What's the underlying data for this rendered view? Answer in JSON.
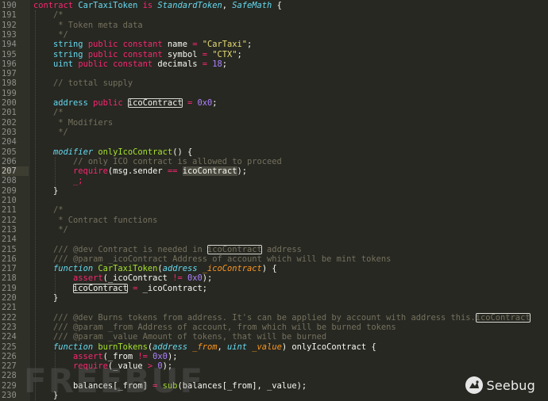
{
  "editor": {
    "active_line": 207,
    "lines": [
      {
        "n": "190",
        "tokens": [
          [
            "kw",
            "contract "
          ],
          [
            "type",
            "CarTaxiToken "
          ],
          [
            "kw",
            "is "
          ],
          [
            "typei",
            "StandardToken"
          ],
          [
            "pl",
            ", "
          ],
          [
            "typei",
            "SafeMath"
          ],
          [
            "pl",
            " {"
          ]
        ]
      },
      {
        "n": "191",
        "tokens": [
          [
            "pl",
            "    "
          ],
          [
            "cmt",
            "/*"
          ]
        ]
      },
      {
        "n": "192",
        "tokens": [
          [
            "pl",
            "    "
          ],
          [
            "cmt",
            " * Token meta data"
          ]
        ]
      },
      {
        "n": "193",
        "tokens": [
          [
            "pl",
            "    "
          ],
          [
            "cmt",
            " */"
          ]
        ]
      },
      {
        "n": "194",
        "tokens": [
          [
            "pl",
            "    "
          ],
          [
            "type",
            "string "
          ],
          [
            "kw",
            "public constant "
          ],
          [
            "pl",
            "name "
          ],
          [
            "kw",
            "= "
          ],
          [
            "str",
            "\"CarTaxi\""
          ],
          [
            "pl",
            ";"
          ]
        ]
      },
      {
        "n": "195",
        "tokens": [
          [
            "pl",
            "    "
          ],
          [
            "type",
            "string "
          ],
          [
            "kw",
            "public constant "
          ],
          [
            "pl",
            "symbol "
          ],
          [
            "kw",
            "= "
          ],
          [
            "str",
            "\"CTX\""
          ],
          [
            "pl",
            ";"
          ]
        ]
      },
      {
        "n": "196",
        "tokens": [
          [
            "pl",
            "    "
          ],
          [
            "type",
            "uint "
          ],
          [
            "kw",
            "public constant "
          ],
          [
            "pl",
            "decimals "
          ],
          [
            "kw",
            "= "
          ],
          [
            "num",
            "18"
          ],
          [
            "pl",
            ";"
          ]
        ]
      },
      {
        "n": "197",
        "tokens": []
      },
      {
        "n": "198",
        "tokens": [
          [
            "pl",
            "    "
          ],
          [
            "cmt",
            "// tottal supply"
          ]
        ]
      },
      {
        "n": "199",
        "tokens": []
      },
      {
        "n": "200",
        "tokens": [
          [
            "pl",
            "    "
          ],
          [
            "type",
            "address "
          ],
          [
            "kw",
            "public "
          ],
          [
            "hl",
            "icoContract"
          ],
          [
            "pl",
            " "
          ],
          [
            "kw",
            "= "
          ],
          [
            "num",
            "0x0"
          ],
          [
            "pl",
            ";"
          ]
        ]
      },
      {
        "n": "201",
        "tokens": [
          [
            "pl",
            "    "
          ],
          [
            "cmt",
            "/*"
          ]
        ]
      },
      {
        "n": "202",
        "tokens": [
          [
            "pl",
            "    "
          ],
          [
            "cmt",
            " * Modifiers"
          ]
        ]
      },
      {
        "n": "203",
        "tokens": [
          [
            "pl",
            "    "
          ],
          [
            "cmt",
            " */"
          ]
        ]
      },
      {
        "n": "204",
        "tokens": []
      },
      {
        "n": "205",
        "tokens": [
          [
            "pl",
            "    "
          ],
          [
            "typei",
            "modifier "
          ],
          [
            "func",
            "onlyIcoContract"
          ],
          [
            "pl",
            "() {"
          ]
        ]
      },
      {
        "n": "206",
        "tokens": [
          [
            "pl",
            "        "
          ],
          [
            "cmt",
            "// only ICO contract is allowed to proceed"
          ]
        ]
      },
      {
        "n": "207",
        "tokens": [
          [
            "pl",
            "        "
          ],
          [
            "kw",
            "require"
          ],
          [
            "pl",
            "(msg.sender "
          ],
          [
            "kw",
            "== "
          ],
          [
            "hlf",
            "icoContract"
          ],
          [
            "pl",
            ");"
          ]
        ]
      },
      {
        "n": "208",
        "tokens": [
          [
            "pl",
            "        "
          ],
          [
            "kw",
            "_;"
          ]
        ]
      },
      {
        "n": "209",
        "tokens": [
          [
            "pl",
            "    }"
          ]
        ]
      },
      {
        "n": "210",
        "tokens": []
      },
      {
        "n": "211",
        "tokens": [
          [
            "pl",
            "    "
          ],
          [
            "cmt",
            "/*"
          ]
        ]
      },
      {
        "n": "212",
        "tokens": [
          [
            "pl",
            "    "
          ],
          [
            "cmt",
            " * Contract functions"
          ]
        ]
      },
      {
        "n": "213",
        "tokens": [
          [
            "pl",
            "    "
          ],
          [
            "cmt",
            " */"
          ]
        ]
      },
      {
        "n": "214",
        "tokens": []
      },
      {
        "n": "215",
        "tokens": [
          [
            "pl",
            "    "
          ],
          [
            "cmt",
            "/// @dev Contract is needed in "
          ],
          [
            "hlc",
            "icoContract"
          ],
          [
            "cmt",
            " address"
          ]
        ]
      },
      {
        "n": "216",
        "tokens": [
          [
            "pl",
            "    "
          ],
          [
            "cmt",
            "/// @param _icoContract Address of account which will be mint tokens"
          ]
        ]
      },
      {
        "n": "217",
        "tokens": [
          [
            "pl",
            "    "
          ],
          [
            "typei",
            "function "
          ],
          [
            "func",
            "CarTaxiToken"
          ],
          [
            "pl",
            "("
          ],
          [
            "typei",
            "address "
          ],
          [
            "param",
            "_icoContract"
          ],
          [
            "pl",
            ") {"
          ]
        ]
      },
      {
        "n": "218",
        "tokens": [
          [
            "pl",
            "        "
          ],
          [
            "kw",
            "assert"
          ],
          [
            "pl",
            "(_icoContract "
          ],
          [
            "kw",
            "!= "
          ],
          [
            "num",
            "0x0"
          ],
          [
            "pl",
            ");"
          ]
        ]
      },
      {
        "n": "219",
        "tokens": [
          [
            "pl",
            "        "
          ],
          [
            "hl",
            "icoContract"
          ],
          [
            "pl",
            " "
          ],
          [
            "kw",
            "= "
          ],
          [
            "pl",
            "_icoContract;"
          ]
        ]
      },
      {
        "n": "220",
        "tokens": [
          [
            "pl",
            "    }"
          ]
        ]
      },
      {
        "n": "221",
        "tokens": []
      },
      {
        "n": "222",
        "tokens": [
          [
            "pl",
            "    "
          ],
          [
            "cmt",
            "/// @dev Burns tokens from address. It's can be applied by account with address this."
          ],
          [
            "hlc",
            "icoContract"
          ]
        ]
      },
      {
        "n": "223",
        "tokens": [
          [
            "pl",
            "    "
          ],
          [
            "cmt",
            "/// @param _from Address of account, from which will be burned tokens"
          ]
        ]
      },
      {
        "n": "224",
        "tokens": [
          [
            "pl",
            "    "
          ],
          [
            "cmt",
            "/// @param _value Amount of tokens, that will be burned"
          ]
        ]
      },
      {
        "n": "225",
        "tokens": [
          [
            "pl",
            "    "
          ],
          [
            "typei",
            "function "
          ],
          [
            "func",
            "burnTokens"
          ],
          [
            "pl",
            "("
          ],
          [
            "typei",
            "address "
          ],
          [
            "param",
            "_from"
          ],
          [
            "pl",
            ", "
          ],
          [
            "typei",
            "uint "
          ],
          [
            "param",
            "_value"
          ],
          [
            "pl",
            ") onlyIcoContract {"
          ]
        ]
      },
      {
        "n": "226",
        "tokens": [
          [
            "pl",
            "        "
          ],
          [
            "kw",
            "assert"
          ],
          [
            "pl",
            "(_from "
          ],
          [
            "kw",
            "!= "
          ],
          [
            "num",
            "0x0"
          ],
          [
            "pl",
            ");"
          ]
        ]
      },
      {
        "n": "227",
        "tokens": [
          [
            "pl",
            "        "
          ],
          [
            "kw",
            "require"
          ],
          [
            "pl",
            "(_value "
          ],
          [
            "kw",
            "> "
          ],
          [
            "num",
            "0"
          ],
          [
            "pl",
            ");"
          ]
        ]
      },
      {
        "n": "228",
        "tokens": []
      },
      {
        "n": "229",
        "tokens": [
          [
            "pl",
            "        balances[_from] "
          ],
          [
            "kw",
            "= "
          ],
          [
            "func",
            "sub"
          ],
          [
            "pl",
            "(balances[_from], _value);"
          ]
        ]
      },
      {
        "n": "230",
        "tokens": [
          [
            "pl",
            "    }"
          ]
        ]
      }
    ]
  },
  "watermark": {
    "text": "FREEBUF"
  },
  "brand": {
    "name": "Seebug",
    "icon": "seebug-logo-icon"
  },
  "colors": {
    "background": "#272822",
    "keyword": "#f92672",
    "type": "#66d9ef",
    "function": "#a6e22e",
    "param": "#fd971f",
    "string": "#e6db74",
    "number": "#ae81ff",
    "comment": "#75715e"
  }
}
